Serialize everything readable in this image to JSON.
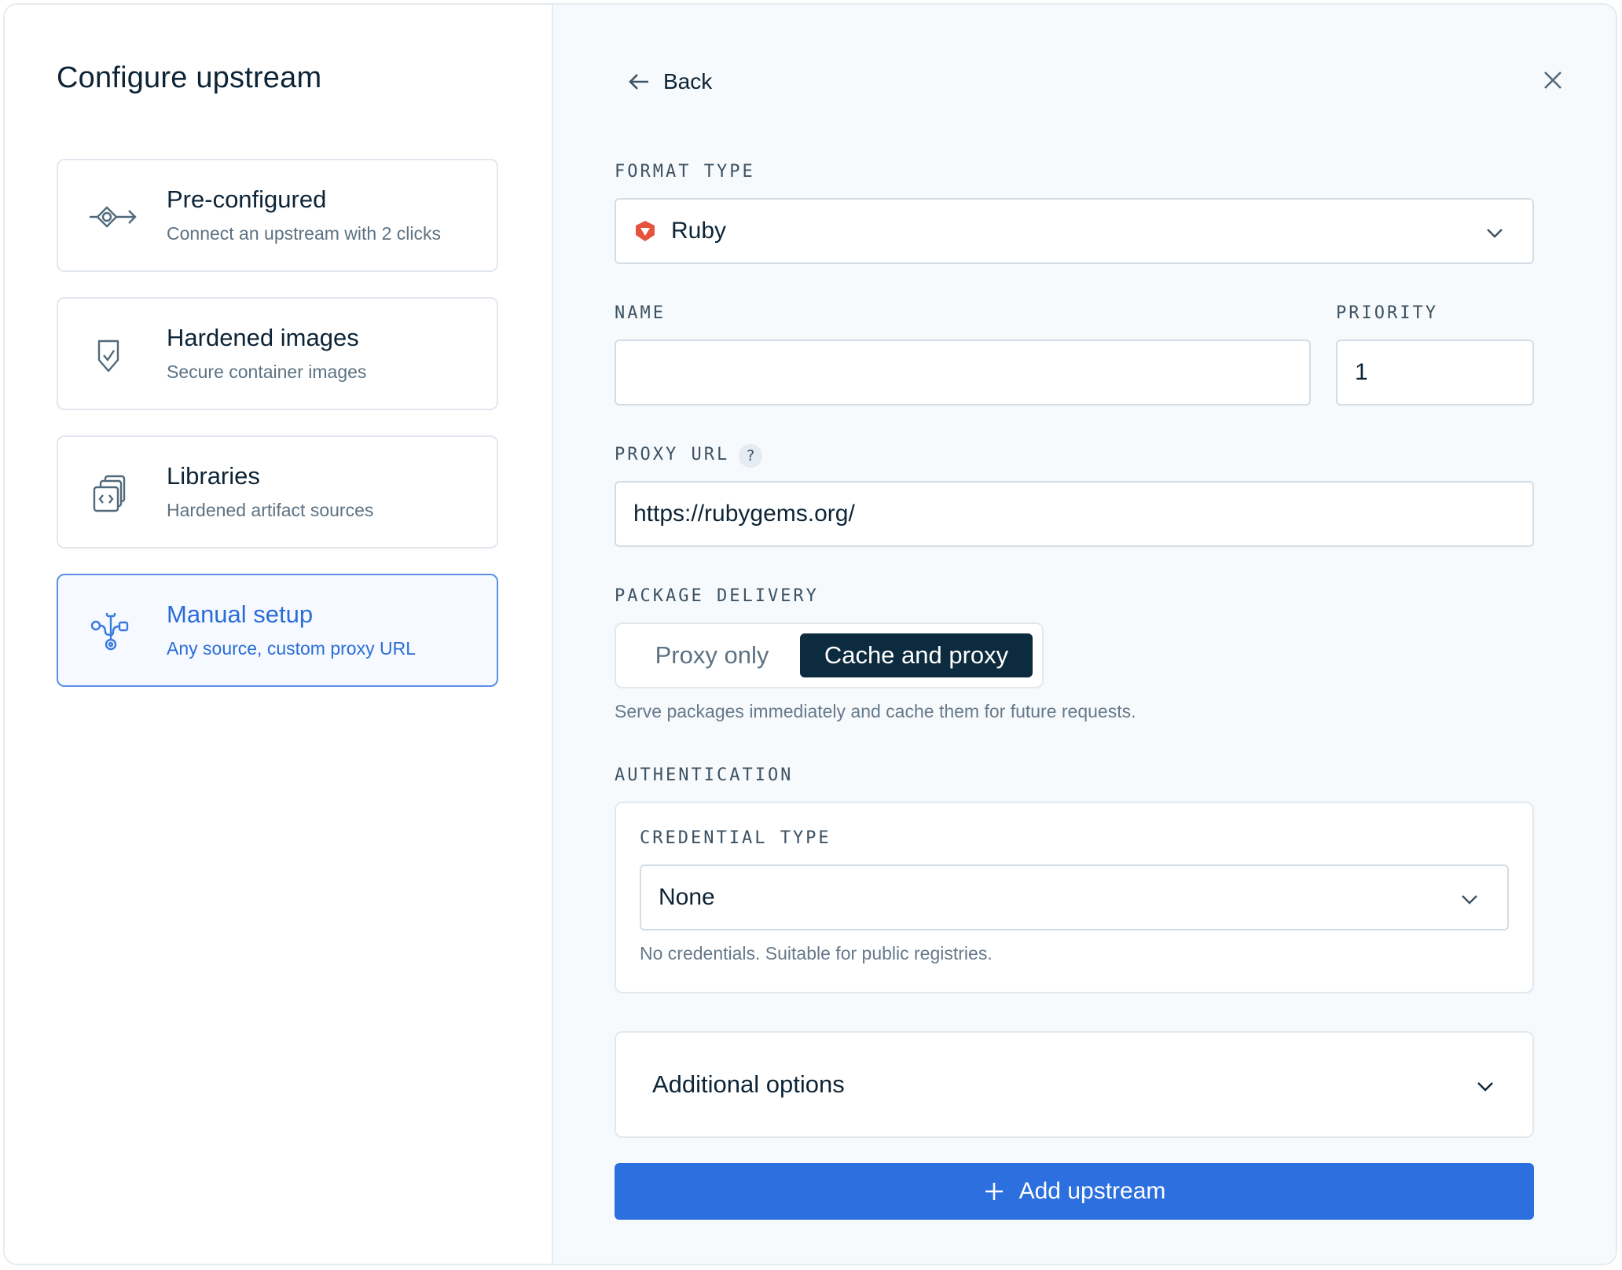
{
  "sidebar": {
    "title": "Configure upstream",
    "options": [
      {
        "title": "Pre-configured",
        "subtitle": "Connect an upstream with 2 clicks",
        "icon": "connect-icon"
      },
      {
        "title": "Hardened images",
        "subtitle": "Secure container images",
        "icon": "shield-check-icon"
      },
      {
        "title": "Libraries",
        "subtitle": "Hardened artifact sources",
        "icon": "code-stack-icon"
      },
      {
        "title": "Manual setup",
        "subtitle": "Any source, custom proxy URL",
        "icon": "network-icon",
        "selected": true
      }
    ]
  },
  "header": {
    "back_label": "Back"
  },
  "form": {
    "format_type": {
      "label": "FORMAT TYPE",
      "value": "Ruby",
      "icon": "ruby-icon"
    },
    "name": {
      "label": "NAME",
      "value": ""
    },
    "priority": {
      "label": "PRIORITY",
      "value": "1"
    },
    "proxy_url": {
      "label": "PROXY URL",
      "help": "?",
      "value": "https://rubygems.org/"
    },
    "package_delivery": {
      "label": "PACKAGE DELIVERY",
      "options": [
        "Proxy only",
        "Cache and proxy"
      ],
      "selected": "Cache and proxy",
      "hint": "Serve packages immediately and cache them for future requests."
    },
    "authentication": {
      "label": "AUTHENTICATION",
      "credential_type_label": "CREDENTIAL TYPE",
      "credential_type_value": "None",
      "hint": "No credentials. Suitable for public registries."
    },
    "additional_options_label": "Additional options",
    "submit_label": "Add upstream"
  },
  "colors": {
    "accent": "#2c6fde",
    "dark_toggle": "#0d2b3e",
    "ruby": "#e5533d"
  }
}
